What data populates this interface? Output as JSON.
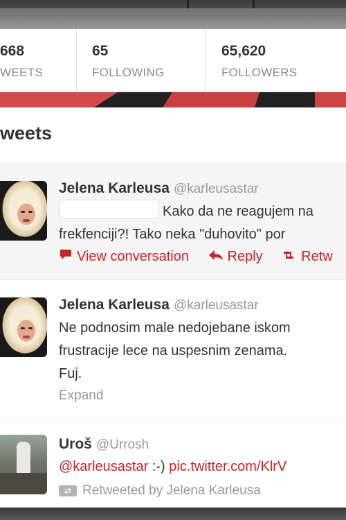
{
  "stats": [
    {
      "number": "668",
      "label": "WEETS"
    },
    {
      "number": "65",
      "label": "FOLLOWING"
    },
    {
      "number": "65,620",
      "label": "FOLLOWERS"
    }
  ],
  "section_title": "weets",
  "tweets": [
    {
      "name": "Jelena Karleusa",
      "handle": "@karleusastar",
      "line1": "Kako da ne reagujem na",
      "line2": "frekfenciji?! Tako neka \"duhovito\" por",
      "actions": {
        "view": "View conversation",
        "reply": "Reply",
        "retweet": "Retw"
      }
    },
    {
      "name": "Jelena Karleusa",
      "handle": "@karleusastar",
      "line1": "Ne podnosim male nedojebane iskom",
      "line2": "frustracije lece na uspesnim zenama.",
      "line3": "Fuj.",
      "expand": "Expand"
    },
    {
      "name": "Uroš",
      "handle": "@Urrosh",
      "mention": "@karleusastar",
      "text": " :-) ",
      "link": "pic.twitter.com/KlrV",
      "retweeted_by": "Retweeted by Jelena Karleusa"
    }
  ],
  "colors": {
    "accent": "#cc2222",
    "muted": "#999999",
    "text": "#333333"
  }
}
